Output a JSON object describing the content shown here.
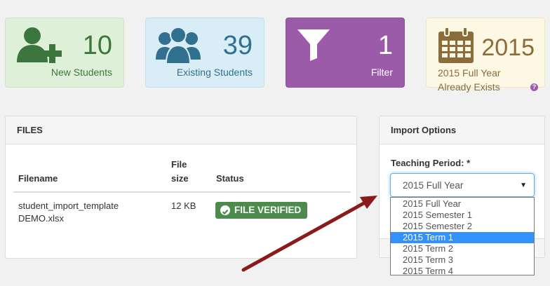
{
  "summary": {
    "new_students": {
      "count": "10",
      "label": "New Students",
      "icon": "user-plus-icon"
    },
    "existing_students": {
      "count": "39",
      "label": "Existing Students",
      "icon": "users-icon"
    },
    "filter": {
      "count": "1",
      "label": "Filter",
      "icon": "filter-icon"
    },
    "period": {
      "year": "2015",
      "label": "2015 Full Year",
      "sublabel": "Already Exists",
      "help": "?",
      "icon": "calendar-icon"
    }
  },
  "files": {
    "title": "FILES",
    "headers": {
      "filename": "Filename",
      "size_l1": "File",
      "size_l2": "size",
      "status": "Status"
    },
    "rows": [
      {
        "filename_l1": "student_import_template",
        "filename_l2": "DEMO.xlsx",
        "size": "12 KB",
        "status": "FILE VERIFIED"
      }
    ]
  },
  "import_options": {
    "title": "Import Options",
    "teaching_period_label": "Teaching Period: *",
    "selected": "2015 Full Year",
    "options": [
      "2015 Full Year",
      "2015 Semester 1",
      "2015 Semester 2",
      "2015 Term 1",
      "2015 Term 2",
      "2015 Term 3",
      "2015 Term 4"
    ],
    "highlighted_option": "2015 Term 1"
  },
  "colors": {
    "new_bg": "#dff0d8",
    "existing_bg": "#d9edf7",
    "filter_bg": "#9c5ba9",
    "period_bg": "#fcf8e3",
    "verified_bg": "#4c8b4c",
    "highlight": "#3390ff",
    "arrow": "#8b1a1a"
  }
}
